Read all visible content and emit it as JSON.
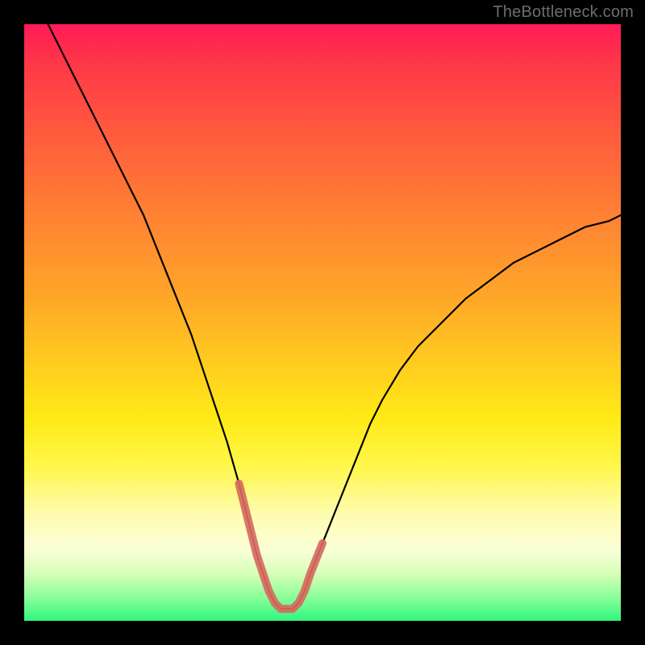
{
  "watermark": "TheBottleneck.com",
  "colors": {
    "frame": "#000000",
    "curve_primary": "#000000",
    "highlight": "#d86a60",
    "green": "#30f57e",
    "red": "#ff1a57"
  },
  "chart_data": {
    "type": "line",
    "title": "",
    "xlabel": "",
    "ylabel": "",
    "xlim": [
      0,
      100
    ],
    "ylim": [
      0,
      100
    ],
    "annotations": [],
    "series": [
      {
        "name": "bottleneck-curve",
        "x": [
          4,
          6,
          8,
          10,
          12,
          14,
          16,
          18,
          20,
          22,
          24,
          26,
          28,
          30,
          32,
          34,
          36,
          38,
          39,
          40,
          41,
          42,
          43,
          44,
          45,
          46,
          47,
          48,
          50,
          52,
          54,
          56,
          58,
          60,
          63,
          66,
          70,
          74,
          78,
          82,
          86,
          90,
          94,
          98,
          100
        ],
        "y": [
          100,
          96,
          92,
          88,
          84,
          80,
          76,
          72,
          68,
          63,
          58,
          53,
          48,
          42,
          36,
          30,
          23,
          15,
          11,
          8,
          5,
          3,
          2,
          2,
          2,
          3,
          5,
          8,
          13,
          18,
          23,
          28,
          33,
          37,
          42,
          46,
          50,
          54,
          57,
          60,
          62,
          64,
          66,
          67,
          68
        ]
      },
      {
        "name": "highlight-segment",
        "x": [
          36,
          38,
          39,
          40,
          41,
          42,
          43,
          44,
          45,
          46,
          47,
          48,
          50
        ],
        "y": [
          23,
          15,
          11,
          8,
          5,
          3,
          2,
          2,
          2,
          3,
          5,
          8,
          13
        ]
      }
    ]
  }
}
